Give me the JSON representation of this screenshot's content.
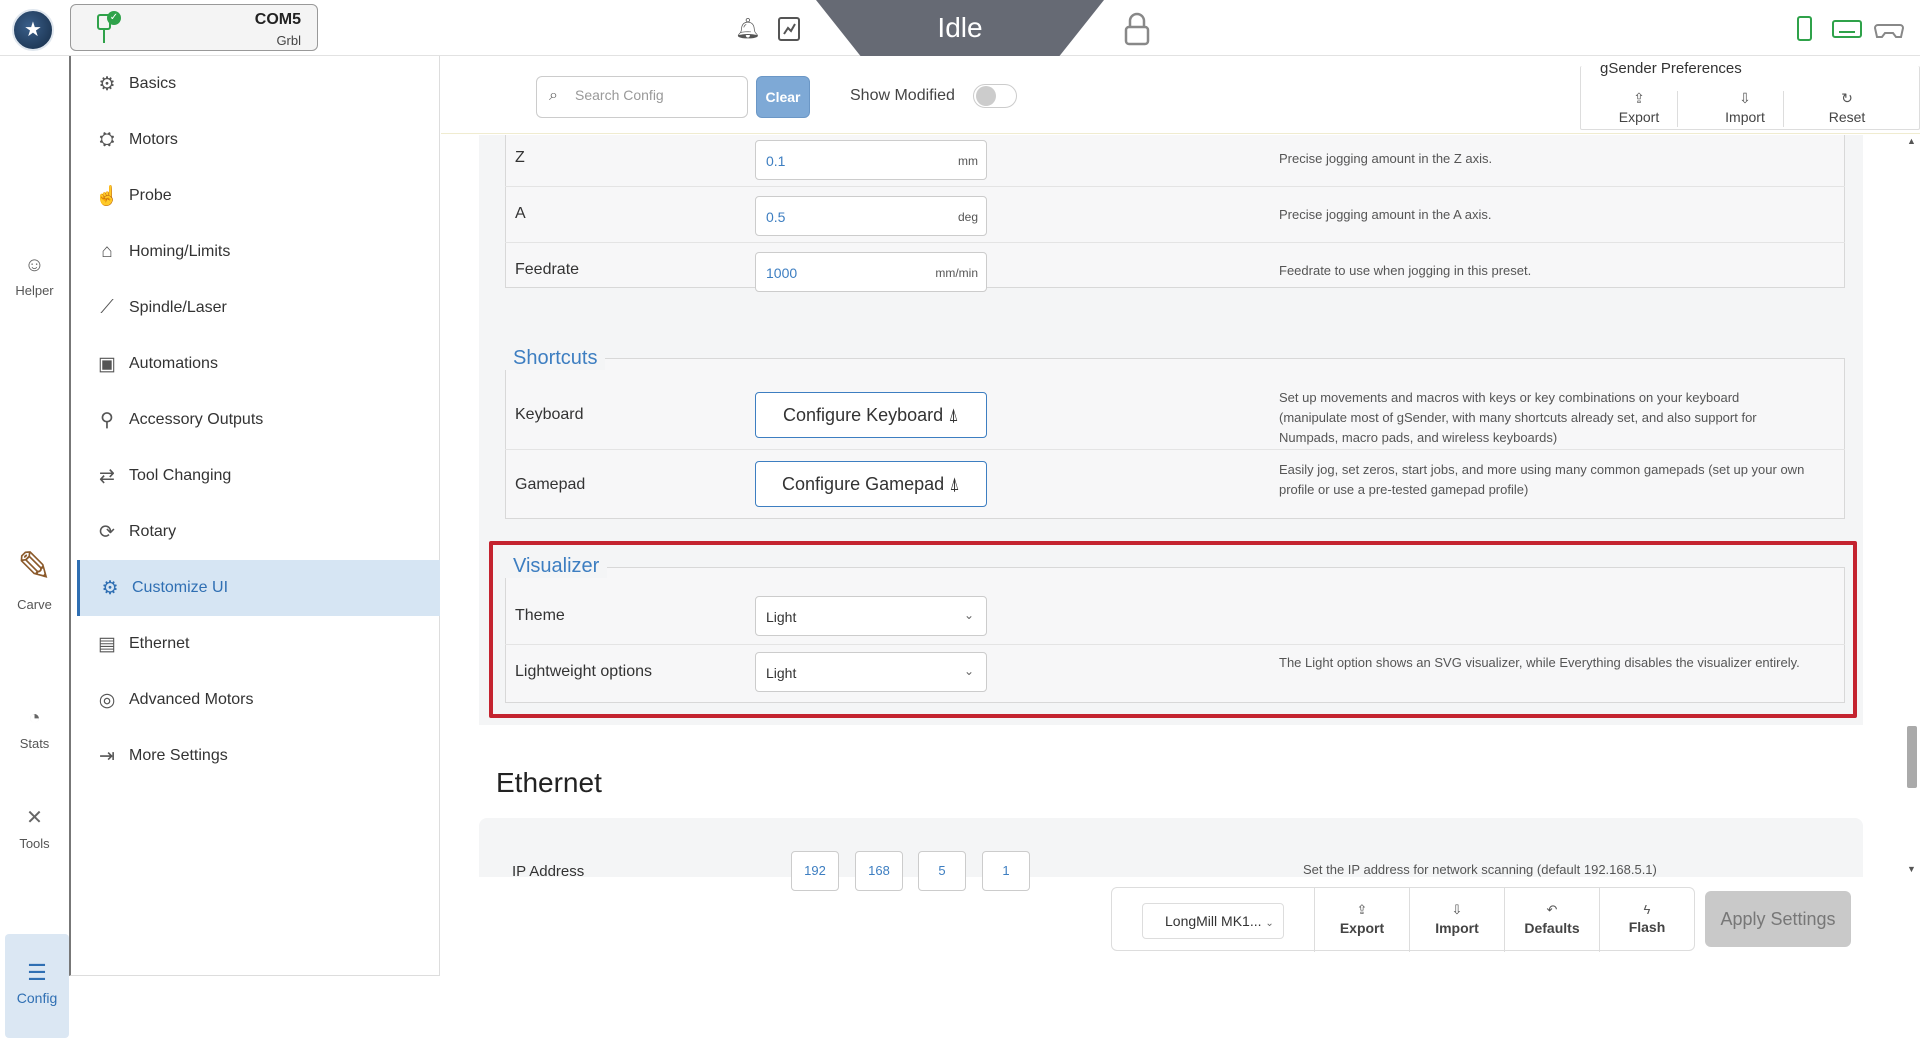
{
  "topbar": {
    "device": {
      "port": "COM5",
      "firmware": "Grbl"
    },
    "state": "Idle"
  },
  "rail": {
    "items": [
      {
        "label": "Helper",
        "icon": "helper-icon"
      },
      {
        "label": "Carve",
        "icon": "carve-icon"
      },
      {
        "label": "Stats",
        "icon": "stats-icon"
      },
      {
        "label": "Tools",
        "icon": "tools-icon"
      },
      {
        "label": "Config",
        "icon": "config-icon"
      }
    ]
  },
  "menu": {
    "items": [
      {
        "label": "Basics",
        "icon": "gear-icon",
        "glyph": "⚙"
      },
      {
        "label": "Motors",
        "icon": "motor-icon",
        "glyph": "⛭"
      },
      {
        "label": "Probe",
        "icon": "probe-icon",
        "glyph": "☝"
      },
      {
        "label": "Homing/Limits",
        "icon": "home-icon",
        "glyph": "⌂"
      },
      {
        "label": "Spindle/Laser",
        "icon": "spindle-icon",
        "glyph": "⟋"
      },
      {
        "label": "Automations",
        "icon": "robot-icon",
        "glyph": "▣"
      },
      {
        "label": "Accessory Outputs",
        "icon": "pin-icon",
        "glyph": "⚲"
      },
      {
        "label": "Tool Changing",
        "icon": "swap-icon",
        "glyph": "⇄"
      },
      {
        "label": "Rotary",
        "icon": "rotary-icon",
        "glyph": "⟳"
      },
      {
        "label": "Customize UI",
        "icon": "customize-icon",
        "glyph": "⚙",
        "active": true
      },
      {
        "label": "Ethernet",
        "icon": "ethernet-icon",
        "glyph": "▤"
      },
      {
        "label": "Advanced Motors",
        "icon": "advanced-motor-icon",
        "glyph": "◎"
      },
      {
        "label": "More Settings",
        "icon": "more-settings-icon",
        "glyph": "⇥"
      }
    ]
  },
  "toolbar": {
    "search_placeholder": "Search Config",
    "clear_label": "Clear",
    "show_modified_label": "Show Modified",
    "show_modified": false,
    "prefs_title": "gSender Preferences",
    "prefs_buttons": [
      {
        "label": "Export",
        "icon": "export-icon"
      },
      {
        "label": "Import",
        "icon": "import-icon"
      },
      {
        "label": "Reset",
        "icon": "reset-icon"
      }
    ]
  },
  "jog_rows": [
    {
      "label": "Z",
      "value": "0.1",
      "unit": "mm",
      "desc": "Precise jogging amount in the Z axis."
    },
    {
      "label": "A",
      "value": "0.5",
      "unit": "deg",
      "desc": "Precise jogging amount in the A axis."
    },
    {
      "label": "Feedrate",
      "value": "1000",
      "unit": "mm/min",
      "desc": "Feedrate to use when jogging in this preset."
    }
  ],
  "shortcuts": {
    "title": "Shortcuts",
    "rows": [
      {
        "label": "Keyboard",
        "button": "Configure Keyboard",
        "desc": "Set up movements and macros with keys or key combinations on your keyboard (manipulate most of gSender, with many shortcuts already set, and also support for Numpads, macro pads, and wireless keyboards)"
      },
      {
        "label": "Gamepad",
        "button": "Configure Gamepad",
        "desc": "Easily jog, set zeros, start jobs, and more using many common gamepads (set up your own profile or use a pre-tested gamepad profile)"
      }
    ]
  },
  "visualizer": {
    "title": "Visualizer",
    "rows": [
      {
        "label": "Theme",
        "value": "Light",
        "desc": ""
      },
      {
        "label": "Lightweight options",
        "value": "Light",
        "desc": "The Light option shows an SVG visualizer, while Everything disables the visualizer entirely."
      }
    ]
  },
  "ethernet": {
    "title": "Ethernet",
    "ip_label": "IP Address",
    "ip_parts": [
      "192",
      "168",
      "5",
      "1"
    ],
    "ip_desc": "Set the IP address for network scanning (default 192.168.5.1)"
  },
  "bottom": {
    "machine": "LongMill MK1...",
    "buttons": [
      {
        "label": "Export",
        "icon": "export-icon"
      },
      {
        "label": "Import",
        "icon": "import-icon"
      },
      {
        "label": "Defaults",
        "icon": "undo-icon"
      },
      {
        "label": "Flash",
        "icon": "flash-icon"
      }
    ],
    "apply_label": "Apply Settings"
  }
}
